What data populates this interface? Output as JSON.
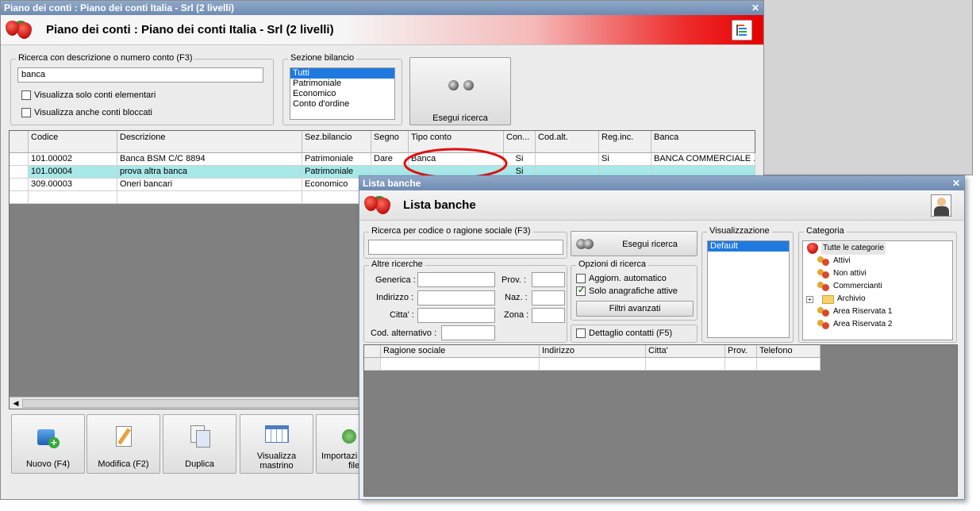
{
  "w1": {
    "title": "Piano dei conti : Piano dei conti Italia - Srl (2 livelli)",
    "banner_title": "Piano dei conti : Piano dei conti Italia - Srl (2 livelli)",
    "search": {
      "legend": "Ricerca con descrizione o numero conto (F3)",
      "value": "banca",
      "opt1": "Visualizza solo conti elementari",
      "opt2": "Visualizza anche conti bloccati"
    },
    "sezione": {
      "legend": "Sezione bilancio",
      "options": [
        "Tutti",
        "Patrimoniale",
        "Economico",
        "Conto d'ordine"
      ]
    },
    "search_button": "Esegui ricerca",
    "columns": [
      "Codice",
      "Descrizione",
      "Sez.bilancio",
      "Segno",
      "Tipo conto",
      "Con...",
      "Cod.alt.",
      "Reg.inc.",
      "Banca"
    ],
    "rows": [
      [
        "101.00002",
        "Banca BSM C/C 8894",
        "Patrimoniale",
        "Dare",
        "Banca",
        "Si",
        "",
        "Si",
        "BANCA COMMERCIALE ..."
      ],
      [
        "101.00004",
        "prova altra banca",
        "Patrimoniale",
        "",
        "",
        "Si",
        "",
        "",
        ""
      ],
      [
        "309.00003",
        "Oneri bancari",
        "Economico",
        "",
        "",
        "",
        "",
        "",
        ""
      ]
    ],
    "toolbar": {
      "nuovo": "Nuovo (F4)",
      "modifica": "Modifica (F2)",
      "duplica": "Duplica",
      "mastrino1": "Visualizza",
      "mastrino2": "mastrino",
      "importa1": "Importazi",
      "importa2": "file"
    },
    "accent_color": "#e60000"
  },
  "w2": {
    "title": "Lista banche",
    "banner_title": "Lista banche",
    "search_legend": "Ricerca per codice o ragione sociale (F3)",
    "search_button": "Esegui ricerca",
    "altre": {
      "legend": "Altre ricerche",
      "generica": "Generica :",
      "prov": "Prov. :",
      "indirizzo": "Indirizzo :",
      "naz": "Naz. :",
      "citta": "Citta' :",
      "zona": "Zona :",
      "cod_alt": "Cod. alternativo :"
    },
    "opzioni": {
      "legend": "Opzioni di ricerca",
      "aggiorn": "Aggiorn. automatico",
      "solo": "Solo anagrafiche attive",
      "filtri": "Filtri avanzati"
    },
    "dettaglio": "Dettaglio contatti (F5)",
    "visualizzazione": {
      "legend": "Visualizzazione",
      "selected": "Default"
    },
    "categoria": {
      "legend": "Categoria",
      "items": [
        "Tutte le categorie",
        "Attivi",
        "Non attivi",
        "Commercianti",
        "Archivio",
        "Area Riservata 1",
        "Area Riservata 2"
      ]
    },
    "columns": [
      "Ragione sociale",
      "Indirizzo",
      "Citta'",
      "Prov.",
      "Telefono"
    ]
  }
}
